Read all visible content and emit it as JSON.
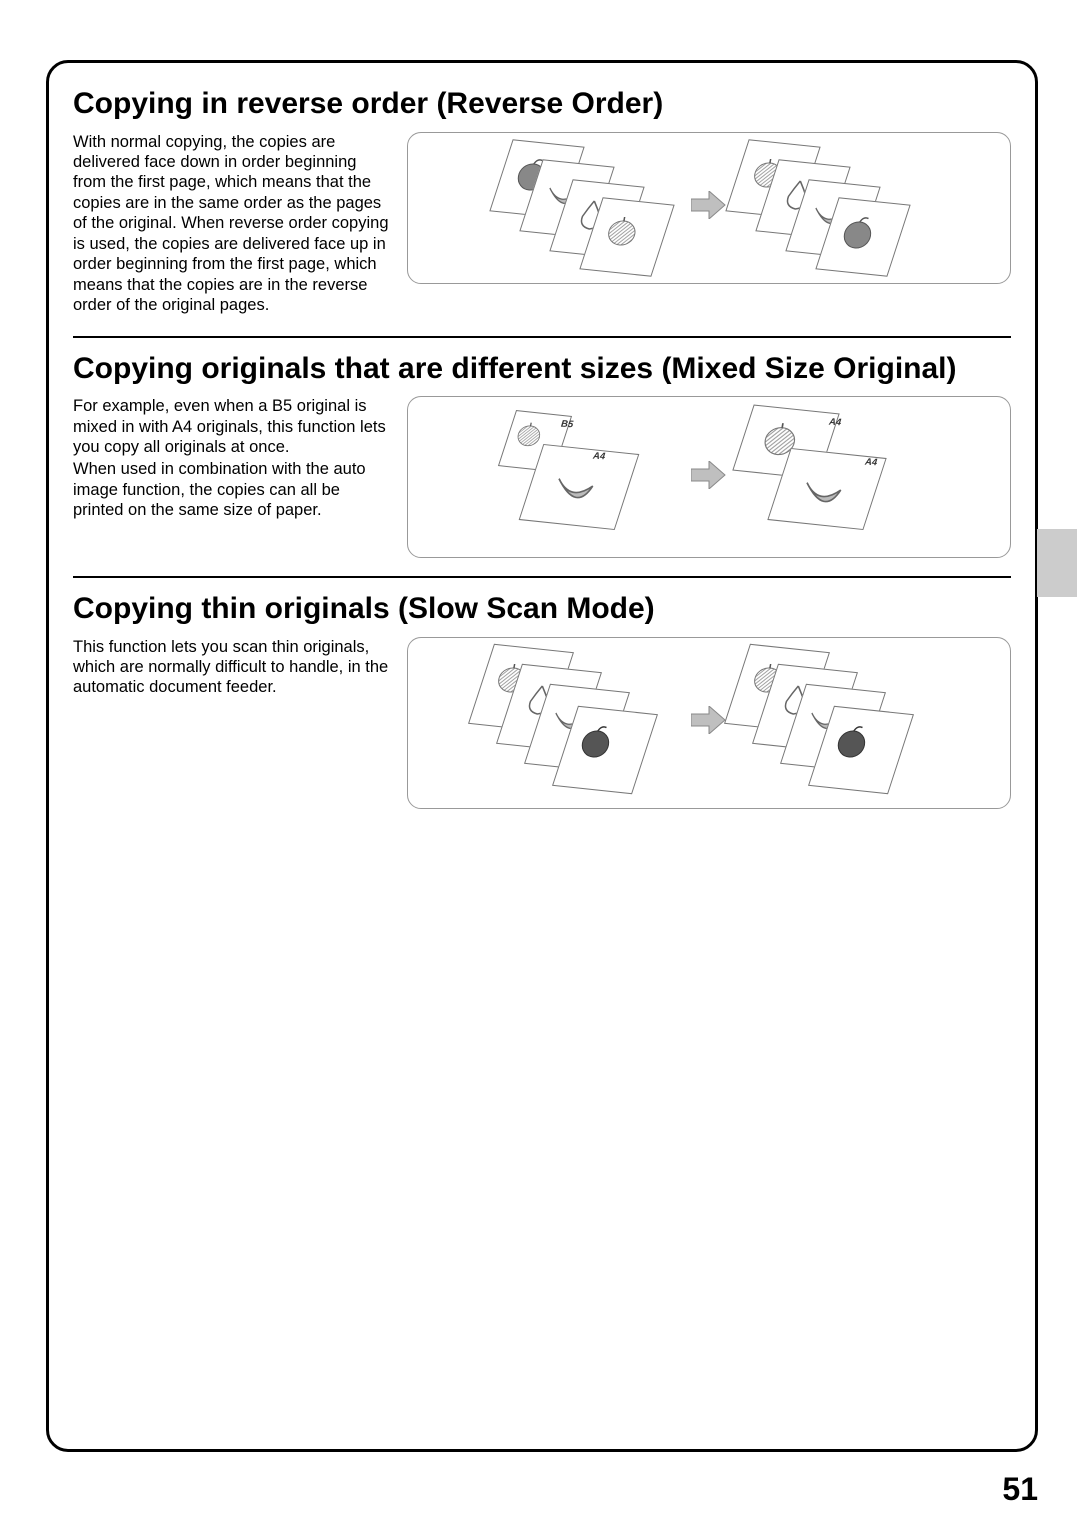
{
  "sections": [
    {
      "title": "Copying in reverse order (Reverse Order)",
      "desc": "With normal copying, the copies are delivered face down in order beginning from the first page, which means that the copies are in the same order as the pages of the original. When reverse order copying is used, the copies are delivered face up in order beginning from the first page, which means that the copies are in the reverse order of the original pages."
    },
    {
      "title": "Copying originals that are different sizes (Mixed Size Original)",
      "desc1": "For example, even when a B5 original is mixed in with A4 originals, this function lets you copy all originals at once.",
      "desc2": "When used in combination with the auto image function, the copies can all be printed on the same size of paper.",
      "labels": {
        "b5": "B5",
        "a4": "A4"
      }
    },
    {
      "title": "Copying thin originals (Slow Scan Mode)",
      "desc": "This function lets you scan thin originals, which are normally difficult to handle, in the automatic document feeder."
    }
  ],
  "page_number": "51"
}
